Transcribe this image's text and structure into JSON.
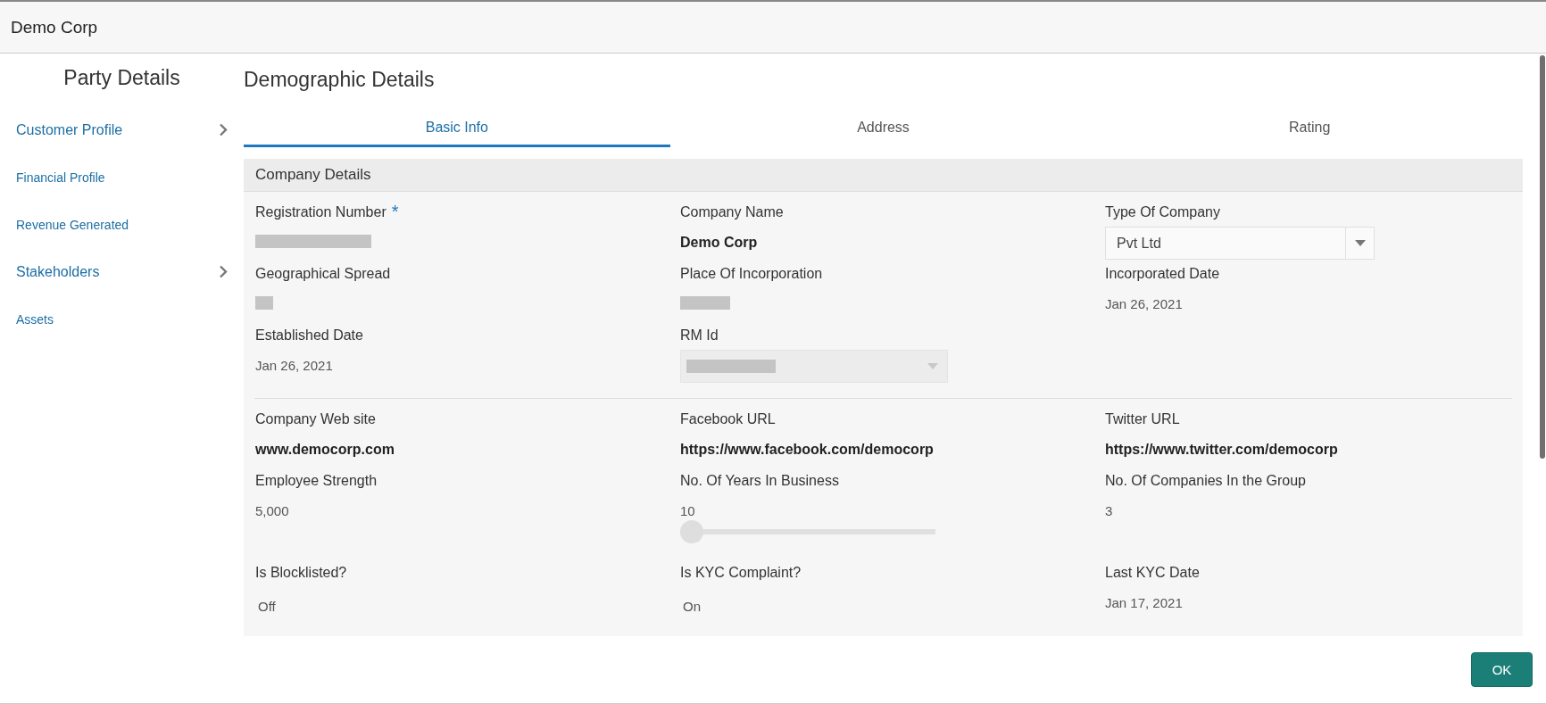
{
  "window": {
    "title": "Demo Corp"
  },
  "sidebar": {
    "title": "Party Details",
    "items": [
      {
        "label": "Customer Profile",
        "expandable": true
      },
      {
        "label": "Financial Profile",
        "expandable": false
      },
      {
        "label": "Revenue Generated",
        "expandable": false
      },
      {
        "label": "Stakeholders",
        "expandable": true
      },
      {
        "label": "Assets",
        "expandable": false
      }
    ]
  },
  "page_title": "Demographic Details",
  "tabs": [
    {
      "label": "Basic Info",
      "selected": true
    },
    {
      "label": "Address",
      "selected": false
    },
    {
      "label": "Rating",
      "selected": false
    }
  ],
  "panel": {
    "title": "Company Details",
    "sections": [
      {
        "fields": [
          {
            "label": "Registration Number",
            "marker": "*",
            "kind": "redacted-long"
          },
          {
            "label": "Company Name",
            "kind": "strong",
            "value": "Demo Corp"
          },
          {
            "label": "Type Of Company",
            "kind": "select",
            "value": "Pvt Ltd"
          },
          {
            "label": "Geographical Spread",
            "kind": "redacted-short"
          },
          {
            "label": "Place Of Incorporation",
            "kind": "redacted-medium"
          },
          {
            "label": "Incorporated Date",
            "kind": "plain",
            "value": "Jan 26, 2021"
          },
          {
            "label": "Established Date",
            "kind": "plain",
            "value": "Jan 26, 2021"
          },
          {
            "label": "RM Id",
            "kind": "redacted-select"
          }
        ]
      },
      {
        "fields": [
          {
            "label": "Company Web site",
            "kind": "strong",
            "value": "www.democorp.com"
          },
          {
            "label": "Facebook URL",
            "kind": "strong",
            "value": "https://www.facebook.com/democorp"
          },
          {
            "label": "Twitter URL",
            "kind": "strong",
            "value": "https://www.twitter.com/democorp"
          },
          {
            "label": "Employee Strength",
            "kind": "plain",
            "value": "5,000"
          },
          {
            "label": "No. Of Years In Business",
            "kind": "slider",
            "value": "10",
            "level": 0
          },
          {
            "label": "No. Of Companies In the Group",
            "kind": "plain",
            "value": "3"
          },
          {
            "label": "Is Blocklisted?",
            "kind": "toggle",
            "value": "Off"
          },
          {
            "label": "Is KYC Complaint?",
            "kind": "toggle",
            "value": "On"
          },
          {
            "label": "Last KYC Date",
            "kind": "plain",
            "value": "Jan 17, 2021"
          }
        ]
      }
    ]
  },
  "footer": {
    "button": "OK"
  }
}
